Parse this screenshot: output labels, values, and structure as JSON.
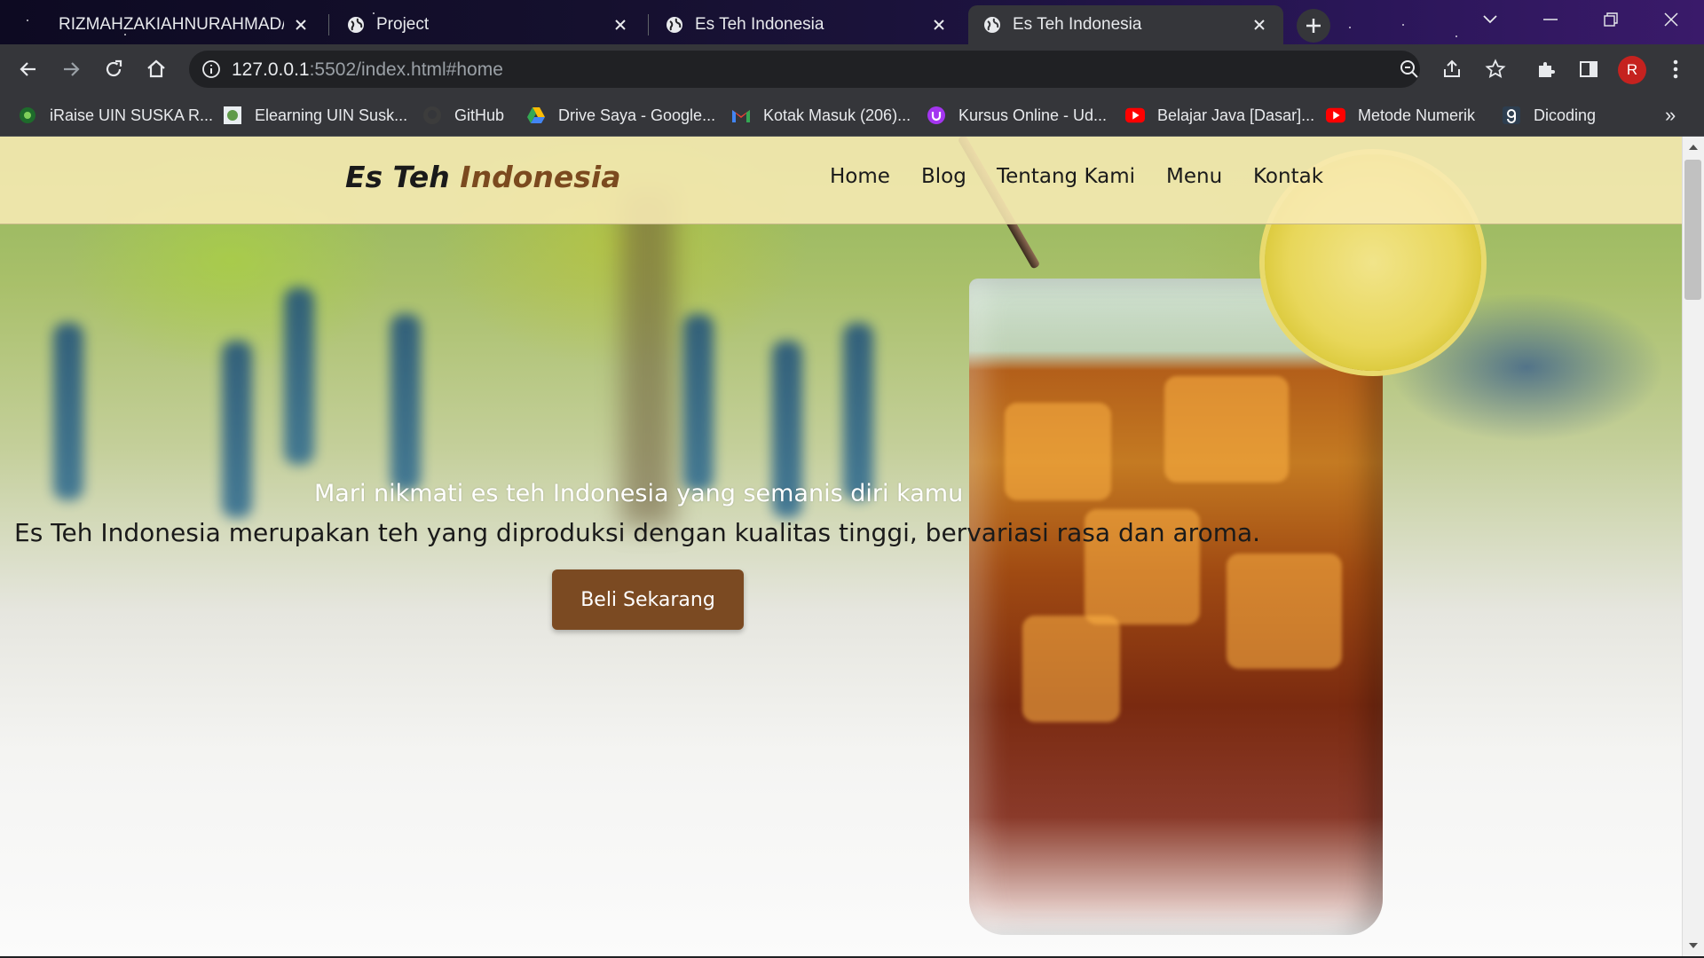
{
  "browser": {
    "tabs": [
      {
        "title": "RIZMAHZAKIAHNURAHMAD/My",
        "icon": "github-icon",
        "active": false
      },
      {
        "title": "Project",
        "icon": "globe-icon",
        "active": false
      },
      {
        "title": "Es Teh Indonesia",
        "icon": "globe-icon",
        "active": false
      },
      {
        "title": "Es Teh Indonesia",
        "icon": "globe-icon",
        "active": true
      }
    ],
    "url": {
      "host": "127.0.0.1",
      "rest": ":5502/index.html#home"
    },
    "avatar_initial": "R",
    "bookmarks": [
      {
        "label": "iRaise UIN SUSKA R...",
        "icon": "iraise-icon"
      },
      {
        "label": "Elearning UIN Susk...",
        "icon": "elearning-icon"
      },
      {
        "label": "GitHub",
        "icon": "github-icon"
      },
      {
        "label": "Drive Saya - Google...",
        "icon": "google-drive-icon"
      },
      {
        "label": "Kotak Masuk (206)...",
        "icon": "gmail-icon"
      },
      {
        "label": "Kursus Online - Ud...",
        "icon": "udemy-icon"
      },
      {
        "label": "Belajar Java [Dasar]...",
        "icon": "youtube-icon"
      },
      {
        "label": "Metode Numerik",
        "icon": "youtube-icon"
      },
      {
        "label": "Dicoding",
        "icon": "dicoding-icon"
      }
    ],
    "more_bookmarks": "»"
  },
  "site": {
    "brand": {
      "part1": "Es Teh ",
      "part2": "Indonesia"
    },
    "nav": [
      "Home",
      "Blog",
      "Tentang Kami",
      "Menu",
      "Kontak"
    ],
    "hero": {
      "subtitle": "Mari nikmati es teh Indonesia yang semanis diri kamu",
      "description": "Es Teh Indonesia merupakan teh yang diproduksi dengan kualitas tinggi, bervariasi rasa dan aroma.",
      "cta": "Beli Sekarang"
    }
  },
  "colors": {
    "brand_accent": "#7b4a1f",
    "navbar_bg": "#f8eab4",
    "cta_bg": "#7b4a22",
    "tab_active": "#35363a"
  }
}
